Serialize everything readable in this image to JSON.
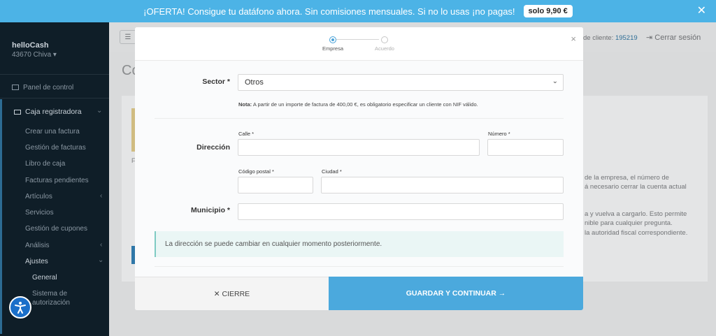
{
  "banner": {
    "text": "¡OFERTA! Consigue tu datáfono ahora. Sin comisiones mensuales. Si no lo usas ¡no pagas!",
    "badge": "solo 9,90 €",
    "close": "✕"
  },
  "sidebar": {
    "brand": "helloCash",
    "location": "43670 Chiva ▾",
    "dashboard": "Panel de control",
    "cash_register": "Caja registradora",
    "items": [
      "Crear una factura",
      "Gestión de facturas",
      "Libro de caja",
      "Facturas pendientes",
      "Artículos",
      "Servicios",
      "Gestión de cupones",
      "Análisis",
      "Ajustes"
    ],
    "sub_items": [
      "General",
      "Sistema de",
      "autorización"
    ]
  },
  "topbar": {
    "client_label": "de cliente: ",
    "client_number": "195219",
    "logout": "Cerrar sesión"
  },
  "page": {
    "title": "Co",
    "card_letter": "F",
    "text_lines": [
      "de la empresa, el número de",
      "á necesario cerrar la cuenta actual",
      "a y vuelva a cargarlo. Esto permite",
      "nible para cualquier pregunta.",
      "la autoridad fiscal correspondiente."
    ]
  },
  "modal": {
    "steps": [
      {
        "label": "Empresa"
      },
      {
        "label": "Acuerdo"
      }
    ],
    "close": "×",
    "sector": {
      "label": "Sector *",
      "value": "Otros"
    },
    "note_prefix": "Nota:",
    "note_text": " A partir de un importe de factura de 400,00 €, es obligatorio especificar un cliente con NIF válido.",
    "address": {
      "label": "Dirección",
      "street_label": "Calle *",
      "street_value": "",
      "number_label": "Número *",
      "number_value": "",
      "postal_label": "Código postal *",
      "postal_value": "",
      "city_label": "Ciudad *",
      "city_value": ""
    },
    "municipality": {
      "label": "Municipio *",
      "value": ""
    },
    "info": "La dirección se puede cambiar en cualquier momento posteriormente.",
    "close_button": "✕  CIERRE",
    "save_button": "GUARDAR Y CONTINUAR →"
  }
}
